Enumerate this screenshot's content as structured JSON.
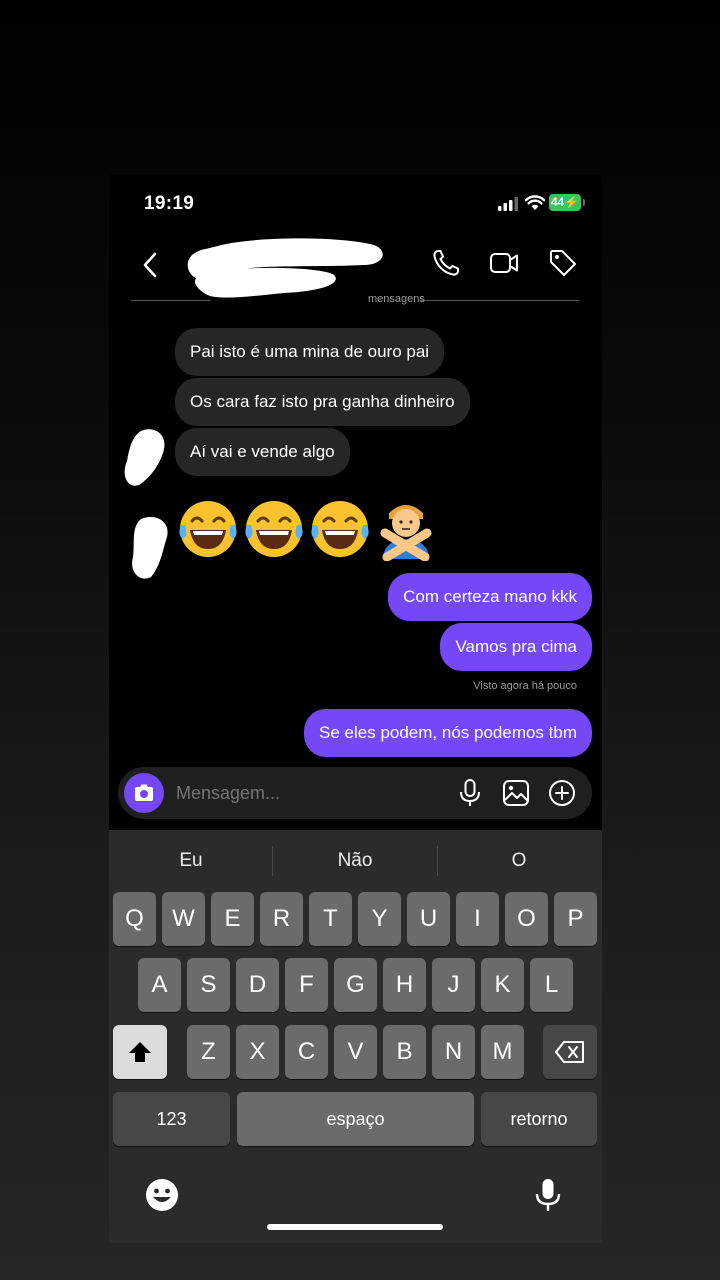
{
  "status": {
    "time": "19:19",
    "battery": "44"
  },
  "header": {
    "divider_label": "mensagens"
  },
  "messages": {
    "incoming": [
      "Pai isto é uma mina de ouro pai",
      "Os cara faz isto pra ganha dinheiro",
      "Aí vai e vende algo"
    ],
    "emojis": [
      "😂",
      "😂",
      "😂",
      "🙅‍♂️"
    ],
    "outgoing": [
      "Com certeza mano kkk",
      "Vamos pra cima"
    ],
    "seen_label": "Visto agora há pouco",
    "last_outgoing": "Se eles podem, nós podemos tbm"
  },
  "composer": {
    "placeholder": "Mensagem..."
  },
  "keyboard": {
    "suggestions": [
      "Eu",
      "Não",
      "O"
    ],
    "row1": [
      "Q",
      "W",
      "E",
      "R",
      "T",
      "Y",
      "U",
      "I",
      "O",
      "P"
    ],
    "row2": [
      "A",
      "S",
      "D",
      "F",
      "G",
      "H",
      "J",
      "K",
      "L"
    ],
    "row3": [
      "Z",
      "X",
      "C",
      "V",
      "B",
      "N",
      "M"
    ],
    "numbers_key": "123",
    "space_key": "espaço",
    "return_key": "retorno"
  },
  "colors": {
    "accent": "#7448f5",
    "incoming_bubble": "#262626",
    "battery": "#35c759"
  }
}
